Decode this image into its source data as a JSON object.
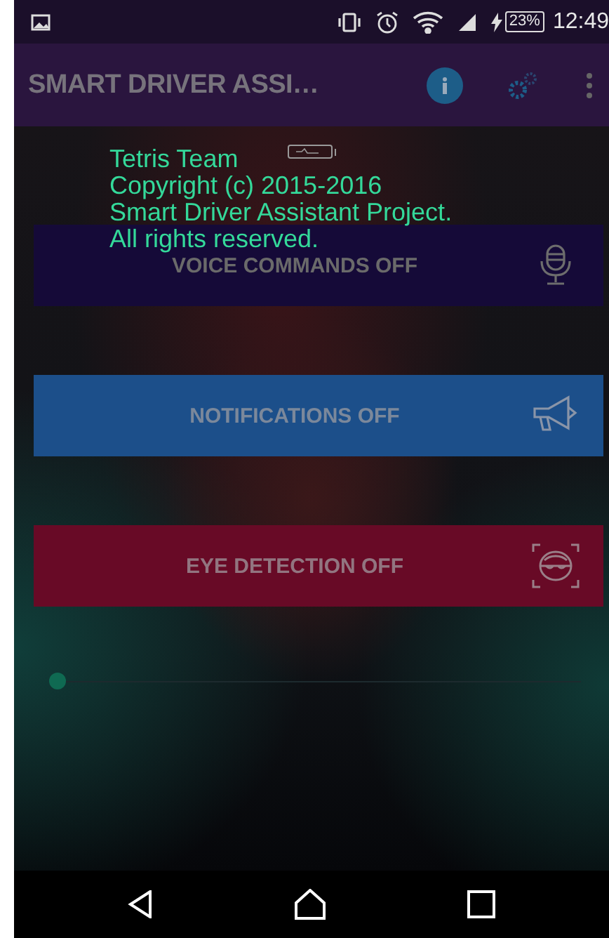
{
  "status_bar": {
    "battery": "23%",
    "time": "12:49"
  },
  "app_bar": {
    "title": "SMART DRIVER ASSI…"
  },
  "toast": {
    "lines": [
      "Tetris Team",
      "Copyright (c) 2015-2016",
      "Smart Driver Assistant Project.",
      "All rights reserved."
    ]
  },
  "toggles": [
    {
      "label": "VOICE COMMANDS OFF",
      "kind": "voice",
      "color": "#150a38"
    },
    {
      "label": "NOTIFICATIONS OFF",
      "kind": "notifications",
      "color": "#1c4f8a"
    },
    {
      "label": "EYE DETECTION OFF",
      "kind": "eye",
      "color": "#680a26"
    }
  ],
  "slider": {
    "level": 0.0
  }
}
